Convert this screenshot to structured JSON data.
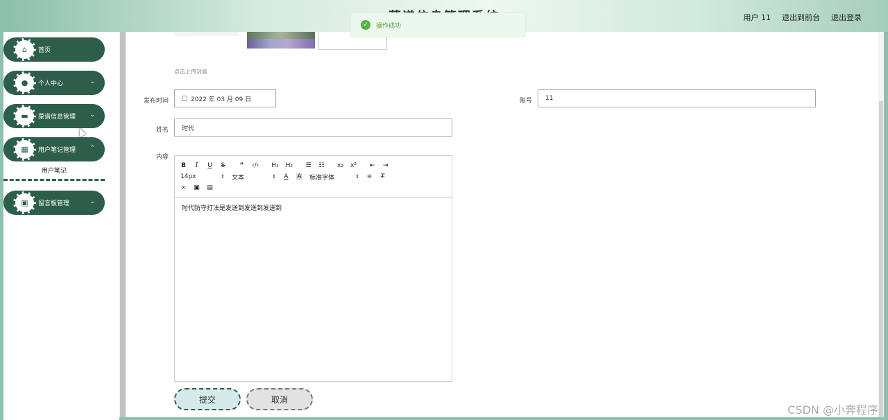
{
  "header": {
    "title_fragment": "菜谱信息管理系统",
    "user": "用户 11",
    "exit_front": "退出到前台",
    "logout": "退出登录"
  },
  "toast": {
    "message": "操作成功"
  },
  "sidebar": {
    "items": [
      {
        "label": "首页",
        "icon": "home-icon"
      },
      {
        "label": "个人中心",
        "icon": "user-icon"
      },
      {
        "label": "菜谱信息管理",
        "icon": "monitor-icon"
      },
      {
        "label": "用户笔记管理",
        "icon": "grid-icon"
      },
      {
        "label": "留言板管理",
        "icon": "clipboard-icon"
      }
    ],
    "submenu": "用户笔记"
  },
  "form": {
    "upload_hint": "点击上传封面",
    "publish_time_label": "发布时间",
    "publish_time_value": "2022 年 03 月 09 日",
    "account_label": "账号",
    "account_value": "11",
    "name_label": "姓名",
    "name_value": "时代",
    "content_label": "内容",
    "content_value": "时代防守打法是发送到发送到发送到",
    "toolbar": {
      "font_size": "14px",
      "heading": "文本",
      "font_family": "标准字体"
    },
    "submit": "提交",
    "cancel": "取消"
  },
  "watermark": "CSDN @小奔程序"
}
